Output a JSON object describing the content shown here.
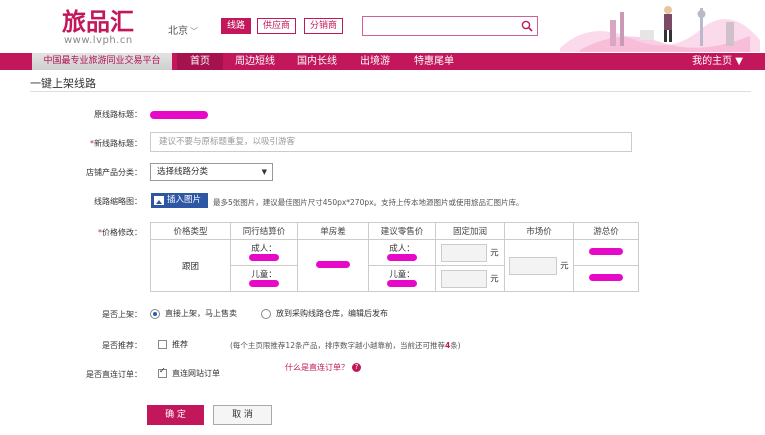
{
  "header": {
    "logo_text": "旅品汇",
    "logo_url": "www.lvph.cn",
    "city": "北京",
    "tabs": [
      "线路",
      "供应商",
      "分销商"
    ],
    "search_value": ""
  },
  "nav": {
    "slogan": "中国最专业旅游同业交易平台",
    "items": [
      "首页",
      "周边短线",
      "国内长线",
      "出境游",
      "特惠尾单"
    ],
    "my_page": "我的主页"
  },
  "page": {
    "title": "一键上架线路"
  },
  "form": {
    "original_title_label": "原线路标题：",
    "new_title_label": "新线路标题：",
    "new_title_placeholder": "建议不要与原标题重复，以吸引游客",
    "category_label": "店铺产品分类：",
    "category_value": "选择线路分类",
    "image_label": "线路缩略图：",
    "image_button": "插入图片",
    "image_hint": "最多5张图片，建议最佳图片尺寸450px*270px。支持上传本地源图片或使用旅品汇图片库。",
    "price_label": "价格修改：",
    "price_table": {
      "headers": [
        "价格类型",
        "同行结算价",
        "单房差",
        "建议零售价",
        "固定加润",
        "市场价",
        "游总价"
      ],
      "type": "跟团",
      "adult": "成人：",
      "child": "儿童：",
      "unit": "元"
    },
    "shelf_label": "是否上架：",
    "shelf_options": [
      "直接上架，马上售卖",
      "放到采购线路仓库，编辑后发布"
    ],
    "recommend_label": "是否推荐：",
    "recommend_option": "推荐",
    "recommend_hint_prefix": "(每个主页限推荐12条产品，排序数字越小越靠前，当前还可推荐",
    "recommend_count": "4",
    "recommend_hint_suffix": "条)",
    "direct_label": "是否直连订单：",
    "direct_option": "直连网站订单",
    "direct_question": "什么是直连订单？",
    "ok_button": "确 定",
    "cancel_button": "取 消"
  },
  "colors": {
    "brand": "#c2185b",
    "button_blue": "#2d56a5",
    "redaction": "#e60ac8"
  }
}
